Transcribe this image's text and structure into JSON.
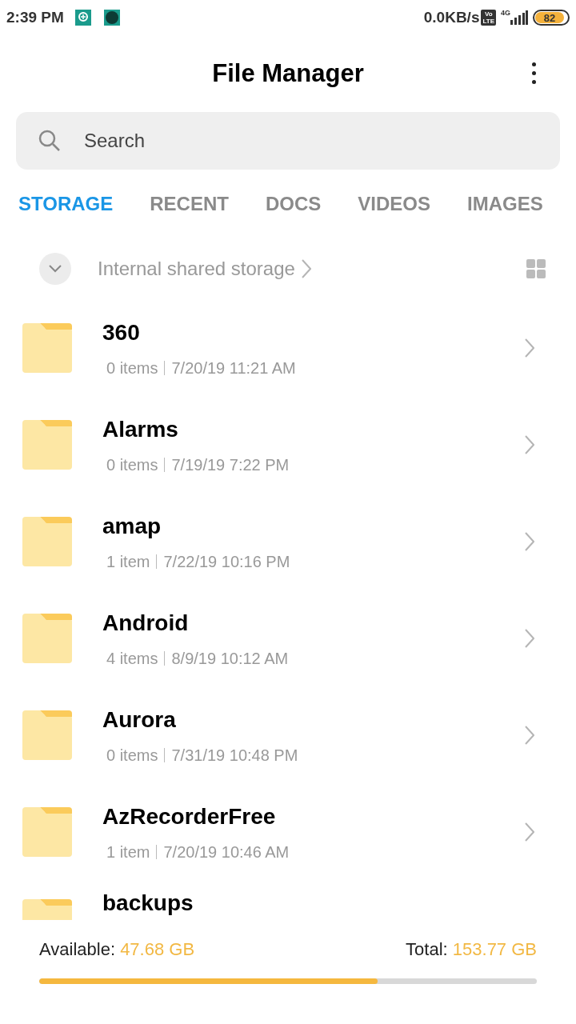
{
  "status_bar": {
    "time": "2:39 PM",
    "speed": "0.0KB/s",
    "volte_top": "Vo",
    "volte_bottom": "LTE",
    "network": "4G",
    "battery": "82"
  },
  "header": {
    "title": "File Manager"
  },
  "search": {
    "placeholder": "Search"
  },
  "tabs": [
    {
      "label": "STORAGE",
      "selected": true
    },
    {
      "label": "RECENT",
      "selected": false
    },
    {
      "label": "DOCS",
      "selected": false
    },
    {
      "label": "VIDEOS",
      "selected": false
    },
    {
      "label": "IMAGES",
      "selected": false
    }
  ],
  "breadcrumb": {
    "path": "Internal shared storage"
  },
  "folders": [
    {
      "name": "360",
      "count": "0 items",
      "date": "7/20/19 11:21 AM"
    },
    {
      "name": "Alarms",
      "count": "0 items",
      "date": "7/19/19 7:22 PM"
    },
    {
      "name": "amap",
      "count": "1 item",
      "date": "7/22/19 10:16 PM"
    },
    {
      "name": "Android",
      "count": "4 items",
      "date": "8/9/19 10:12 AM"
    },
    {
      "name": "Aurora",
      "count": "0 items",
      "date": "7/31/19 10:48 PM"
    },
    {
      "name": "AzRecorderFree",
      "count": "1 item",
      "date": "7/20/19 10:46 AM"
    },
    {
      "name": "backups"
    }
  ],
  "storage": {
    "available_label": "Available:",
    "available": "47.68 GB",
    "total_label": "Total:",
    "total": "153.77 GB",
    "level": 0.68
  }
}
